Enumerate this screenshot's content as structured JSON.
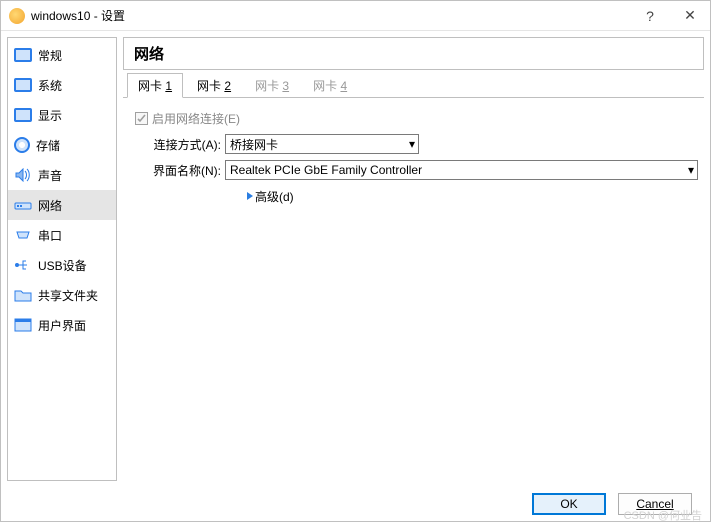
{
  "window": {
    "title": "windows10 - 设置"
  },
  "titlebar": {
    "help": "?",
    "close": "✕"
  },
  "sidebar": {
    "items": [
      {
        "label": "常规"
      },
      {
        "label": "系统"
      },
      {
        "label": "显示"
      },
      {
        "label": "存储"
      },
      {
        "label": "声音"
      },
      {
        "label": "网络"
      },
      {
        "label": "串口"
      },
      {
        "label": "USB设备"
      },
      {
        "label": "共享文件夹"
      },
      {
        "label": "用户界面"
      }
    ],
    "selected_index": 5
  },
  "main": {
    "heading": "网络",
    "tabs": [
      {
        "label": "网卡 ",
        "accel": "1"
      },
      {
        "label": "网卡 ",
        "accel": "2"
      },
      {
        "label": "网卡 ",
        "accel": "3"
      },
      {
        "label": "网卡 ",
        "accel": "4"
      }
    ],
    "selected_tab": 0,
    "enable": {
      "label": "启用网络连接(E)",
      "checked": true,
      "disabled": true
    },
    "attach": {
      "label": "连接方式(A):",
      "value": "桥接网卡"
    },
    "iface": {
      "label": "界面名称(N):",
      "value": "Realtek PCIe GbE Family Controller"
    },
    "advanced": {
      "label": "高级(d)"
    }
  },
  "footer": {
    "ok": "OK",
    "cancel": "Cancel"
  },
  "watermark": "CSDN @何业告"
}
